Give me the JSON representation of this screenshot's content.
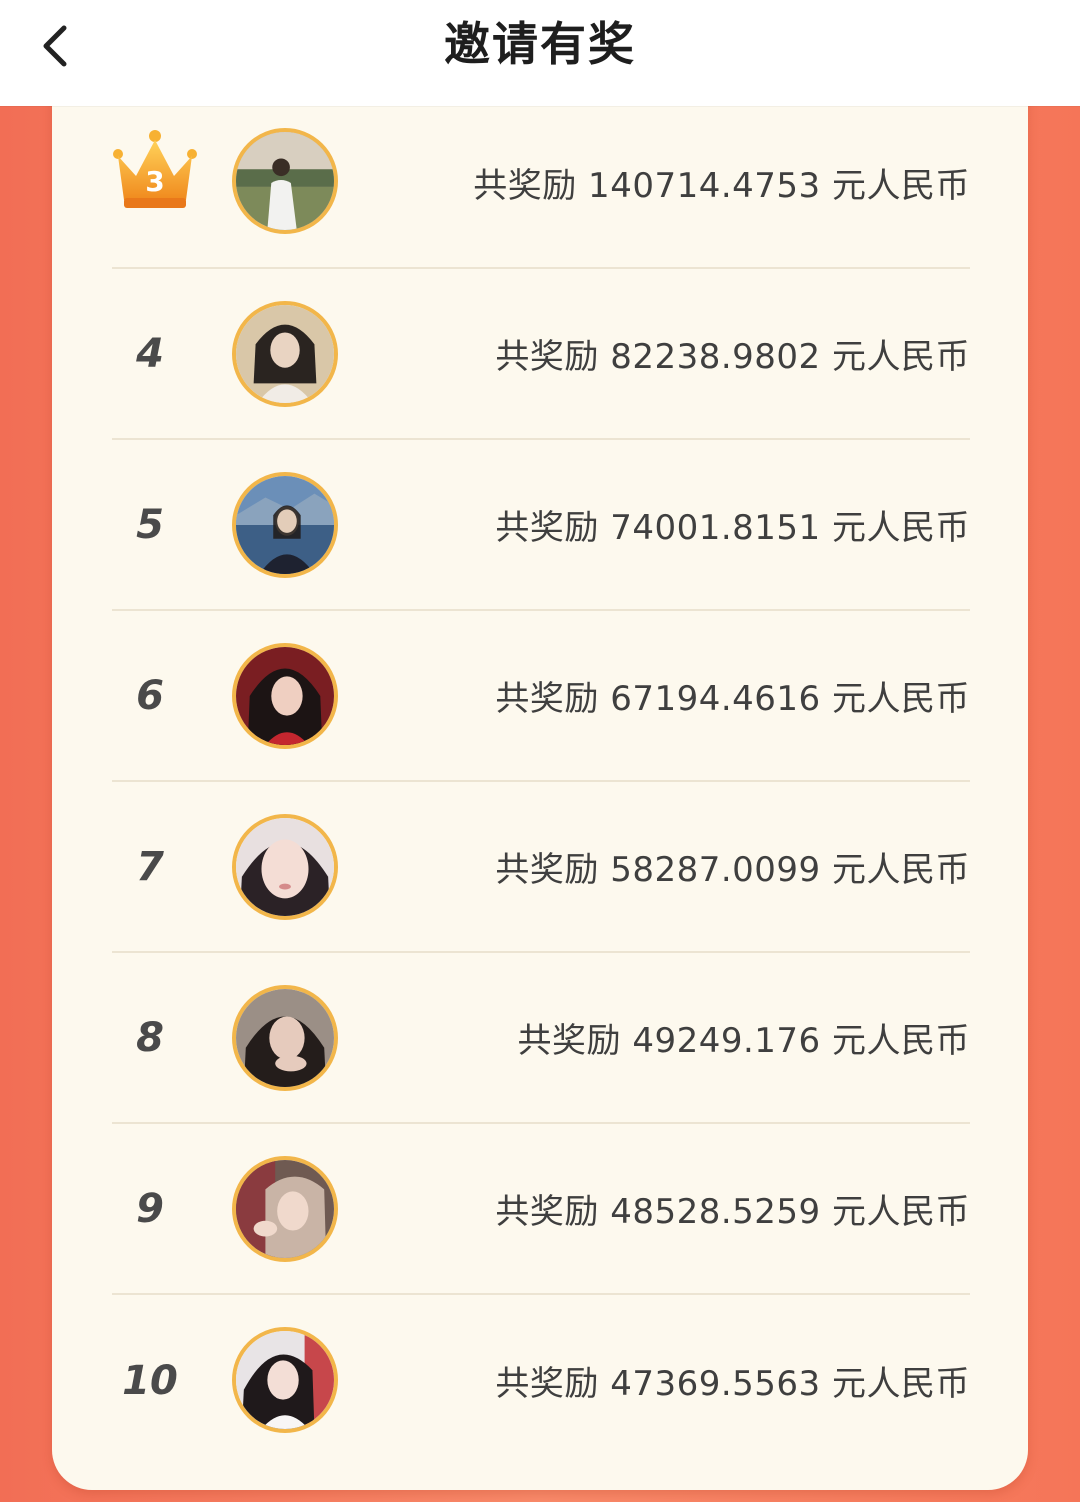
{
  "header": {
    "title": "邀请有奖",
    "back_icon": "chevron-left-icon"
  },
  "colors": {
    "background": "#f57a5e",
    "panel": "#fdf9ee",
    "avatar_ring": "#f2b64a",
    "crown": "#f5a623"
  },
  "ranking": [
    {
      "rank": "3",
      "crown": true,
      "reward": "共奖励 140714.4753 元人民币"
    },
    {
      "rank": "4",
      "crown": false,
      "reward": "共奖励 82238.9802 元人民币"
    },
    {
      "rank": "5",
      "crown": false,
      "reward": "共奖励 74001.8151 元人民币"
    },
    {
      "rank": "6",
      "crown": false,
      "reward": "共奖励 67194.4616 元人民币"
    },
    {
      "rank": "7",
      "crown": false,
      "reward": "共奖励 58287.0099 元人民币"
    },
    {
      "rank": "8",
      "crown": false,
      "reward": "共奖励 49249.176 元人民币"
    },
    {
      "rank": "9",
      "crown": false,
      "reward": "共奖励 48528.5259 元人民币"
    },
    {
      "rank": "10",
      "crown": false,
      "reward": "共奖励 47369.5563 元人民币"
    }
  ]
}
